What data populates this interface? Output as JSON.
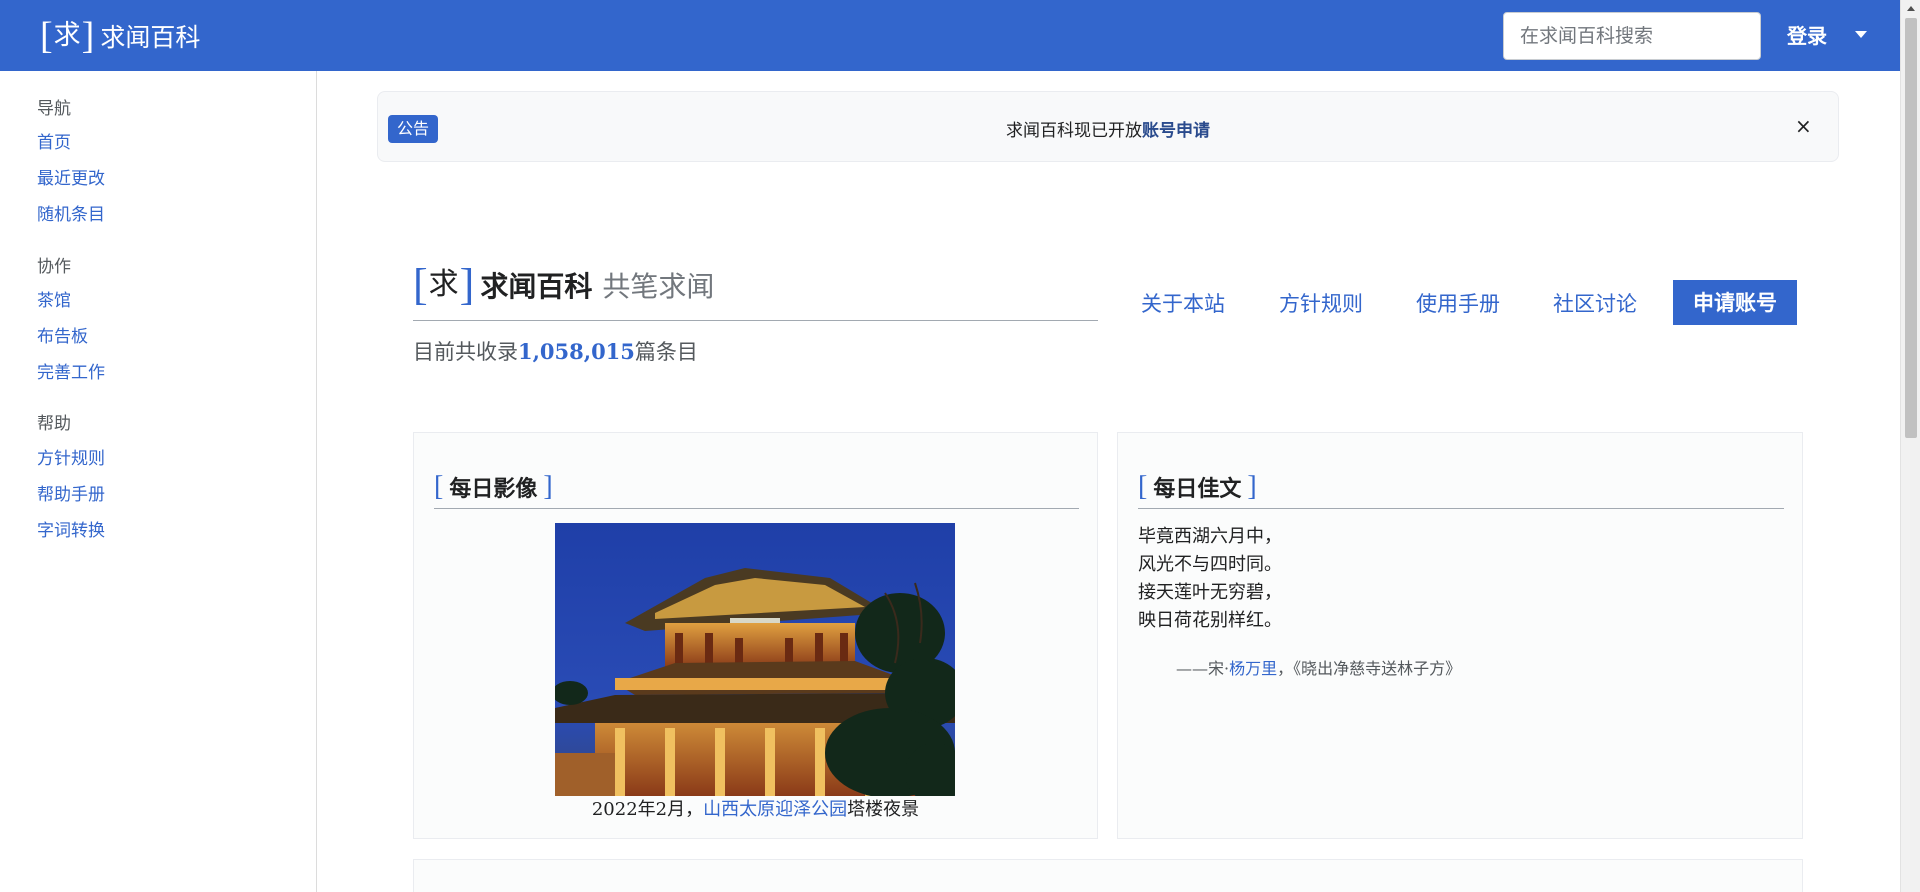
{
  "header": {
    "logo_glyph": "求",
    "logo_text": "求闻百科",
    "search_placeholder": "在求闻百科搜索",
    "login_label": "登录"
  },
  "sidebar": {
    "sections": [
      {
        "heading": "导航",
        "items": [
          "首页",
          "最近更改",
          "随机条目"
        ]
      },
      {
        "heading": "协作",
        "items": [
          "茶馆",
          "布告板",
          "完善工作"
        ]
      },
      {
        "heading": "帮助",
        "items": [
          "方针规则",
          "帮助手册",
          "字词转换"
        ]
      }
    ]
  },
  "notice": {
    "badge": "公告",
    "text": "求闻百科现已开放",
    "link": "账号申请",
    "close": "×"
  },
  "hero": {
    "glyph": "求",
    "title": "求闻百科",
    "slogan": "共笔求闻",
    "count_prefix": "目前共收录",
    "count": "1,058,015",
    "count_suffix": "篇条目",
    "nav": [
      "关于本站",
      "方针规则",
      "使用手册",
      "社区讨论"
    ],
    "apply_button": "申请账号"
  },
  "daily_image": {
    "heading": "每日影像",
    "caption_prefix": "2022年2月，",
    "caption_link": "山西太原迎泽公园",
    "caption_suffix": "塔楼夜景"
  },
  "daily_text": {
    "heading": "每日佳文",
    "lines": [
      "毕竟西湖六月中，",
      "风光不与四时同。",
      "接天莲叶无穷碧，",
      "映日荷花别样红。"
    ],
    "attrib_prefix": "——宋·",
    "attrib_link": "杨万里",
    "attrib_suffix": "，《晓出净慈寺送林子方》"
  },
  "colors": {
    "brand": "#3366cc",
    "link": "#3366cc",
    "notice_link": "#2a4b8d"
  }
}
